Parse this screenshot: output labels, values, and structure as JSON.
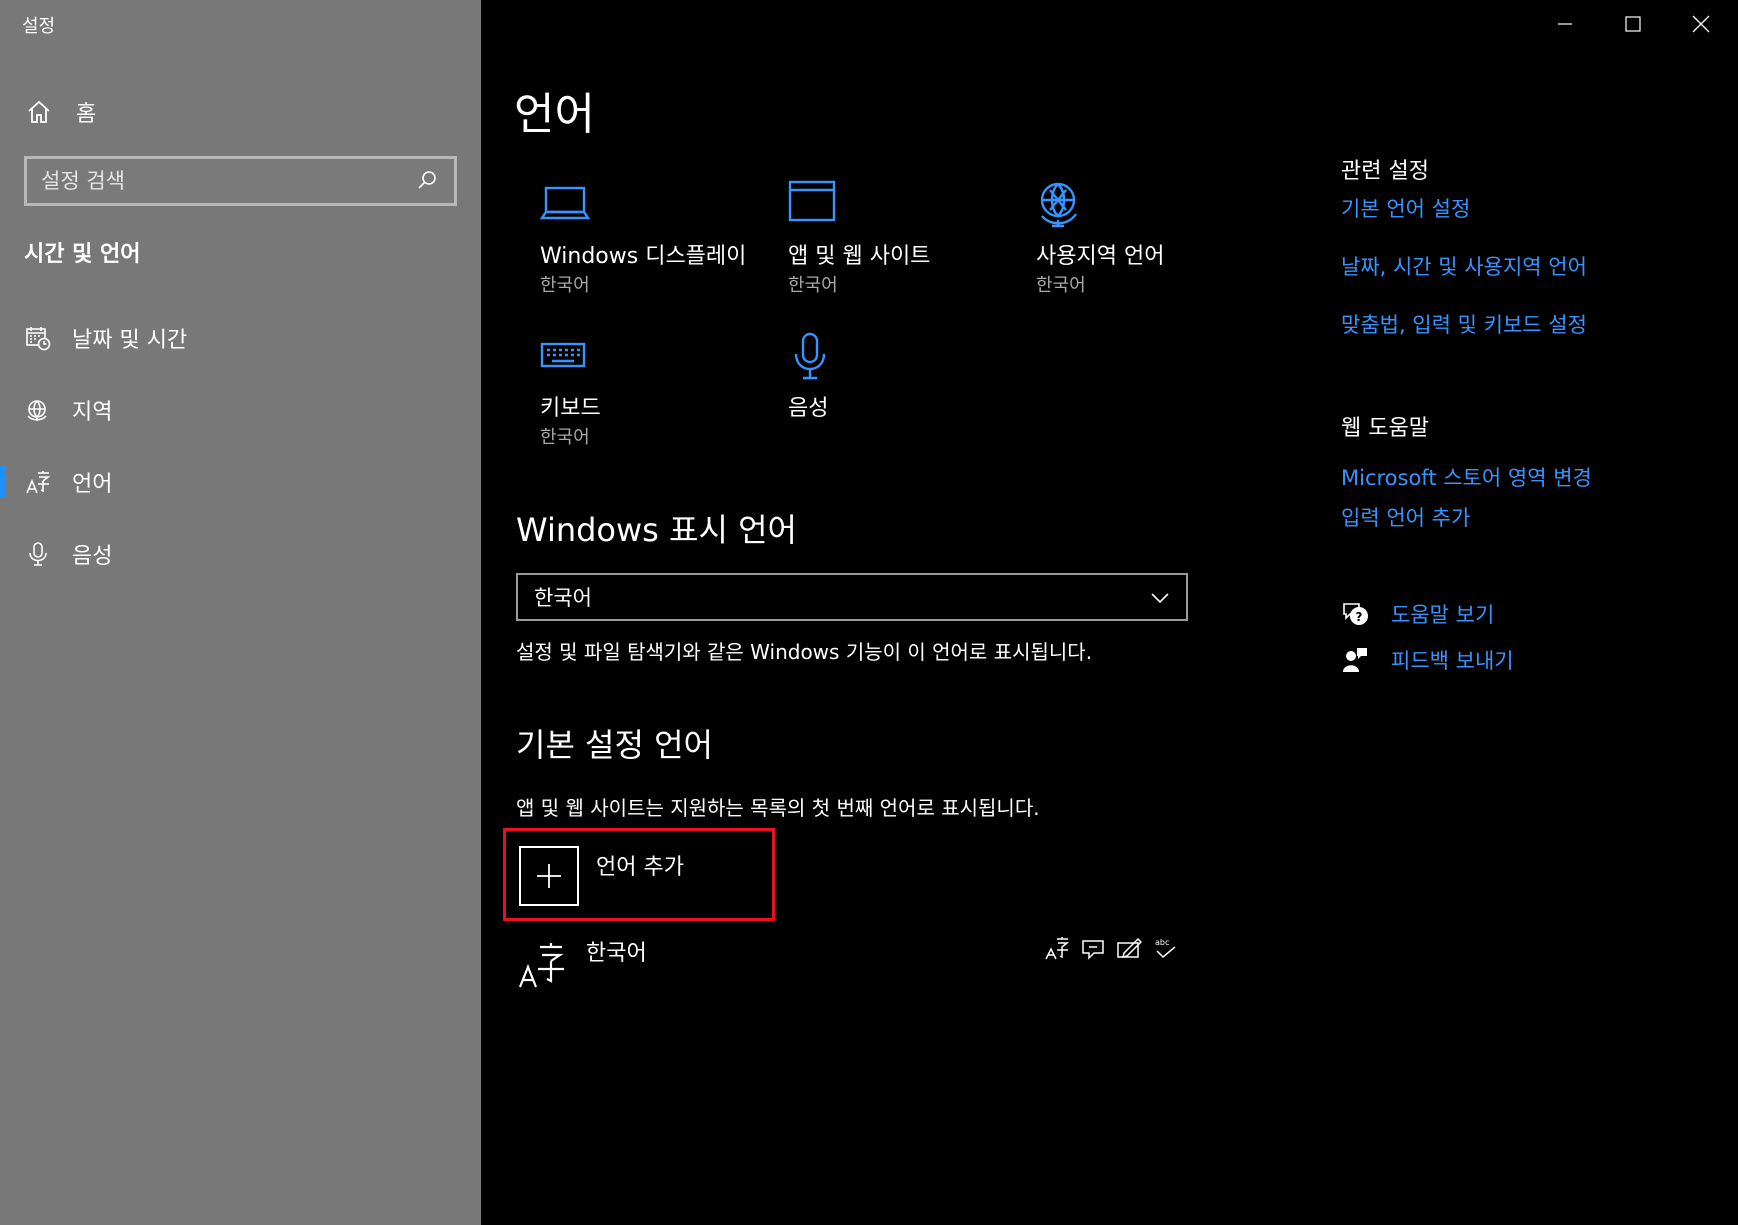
{
  "window": {
    "title": "설정",
    "controls": [
      "minimize-icon",
      "maximize-icon",
      "close-icon"
    ]
  },
  "sidebar": {
    "home_label": "홈",
    "search_placeholder": "설정 검색",
    "section_title": "시간 및 언어",
    "items": [
      {
        "label": "날짜 및 시간",
        "icon": "calendar-clock-icon",
        "active": false
      },
      {
        "label": "지역",
        "icon": "globe-icon",
        "active": false
      },
      {
        "label": "언어",
        "icon": "language-icon",
        "active": true
      },
      {
        "label": "음성",
        "icon": "microphone-icon",
        "active": false
      }
    ],
    "accent": "#1e90ff"
  },
  "main": {
    "title": "언어",
    "tiles": [
      {
        "name": "Windows 디스플레이",
        "sub": "한국어",
        "icon": "laptop-icon"
      },
      {
        "name": "앱 및 웹 사이트",
        "sub": "한국어",
        "icon": "browser-window-icon"
      },
      {
        "name": "사용지역 언어",
        "sub": "한국어",
        "icon": "region-globe-icon"
      },
      {
        "name": "키보드",
        "sub": "한국어",
        "icon": "keyboard-icon"
      },
      {
        "name": "음성",
        "sub": "",
        "icon": "microphone-icon"
      }
    ],
    "display_lang": {
      "heading": "Windows 표시 언어",
      "selected": "한국어",
      "description": "설정 및 파일 탐색기와 같은 Windows 기능이 이 언어로 표시됩니다."
    },
    "preferred": {
      "heading": "기본 설정 언어",
      "description": "앱 및 웹 사이트는 지원하는 목록의 첫 번째 언어로 표시됩니다.",
      "add_label": "언어 추가",
      "languages": [
        {
          "name": "한국어",
          "features": [
            "display-language-icon",
            "speech-icon",
            "handwriting-icon",
            "spellcheck-icon"
          ]
        }
      ]
    },
    "highlight_color": "#e81123"
  },
  "related": {
    "heading": "관련 설정",
    "links": [
      "기본 언어 설정",
      "날짜, 시간 및 사용지역 언어",
      "맞춤법, 입력 및 키보드 설정"
    ]
  },
  "web_help": {
    "heading": "웹 도움말",
    "links": [
      "Microsoft 스토어 영역 변경",
      "입력 언어 추가"
    ]
  },
  "help": {
    "items": [
      {
        "label": "도움말 보기",
        "icon": "help-chat-icon"
      },
      {
        "label": "피드백 보내기",
        "icon": "feedback-icon"
      }
    ],
    "link_color": "#3794ff"
  }
}
